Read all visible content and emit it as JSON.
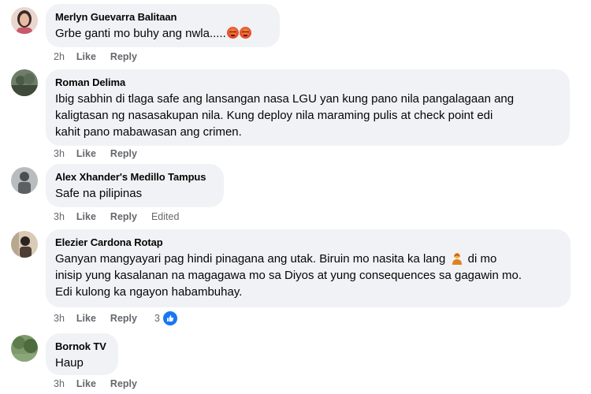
{
  "colors": {
    "bubble": "#f0f2f5",
    "meta": "#65676b",
    "like_blue": "#1877f2",
    "angry": "#e2452a"
  },
  "comments": [
    {
      "author": "Merlyn Guevarra Balitaan",
      "lines": [
        "Grbe ganti mo buhy ang nwla....."
      ],
      "emojis": [
        "angry-face-icon",
        "angry-face-icon"
      ],
      "time": "2h",
      "like": "Like",
      "reply": "Reply"
    },
    {
      "author": "Roman Delima",
      "lines": [
        "Ibig sabhin di tlaga safe ang lansangan nasa LGU yan kung pano nila pangalagaan ang",
        "kaligtasan ng nasasakupan nila. Kung deploy nila maraming pulis at check point edi",
        "kahit pano mabawasan ang crimen."
      ],
      "time": "3h",
      "like": "Like",
      "reply": "Reply"
    },
    {
      "author": "Alex Xhander's Medillo Tampus",
      "lines": [
        "Safe na pilipinas"
      ],
      "time": "3h",
      "like": "Like",
      "reply": "Reply",
      "edited": "Edited"
    },
    {
      "author": "Elezier Cardona Rotap",
      "lines": [
        "Ganyan mangyayari pag hindi pinagana ang utak. Biruin mo nasita ka lang",
        "di mo",
        "inisip yung kasalanan na magagawa mo sa Diyos at yung consequences sa gagawin mo.",
        "Edi kulong ka ngayon habambuhay."
      ],
      "emojis": [
        "person-shrugging-icon"
      ],
      "time": "3h",
      "like": "Like",
      "reply": "Reply",
      "reactions": "3"
    },
    {
      "author": "Bornok TV",
      "lines": [
        "Haup"
      ],
      "time": "3h",
      "like": "Like",
      "reply": "Reply"
    }
  ]
}
